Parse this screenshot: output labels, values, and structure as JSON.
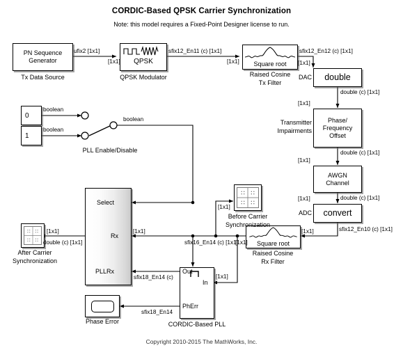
{
  "header": {
    "title": "CORDIC-Based QPSK Carrier Synchronization",
    "note": "Note: this model requires a Fixed-Point Designer license to run."
  },
  "footer": {
    "copyright": "Copyright 2010-2015 The MathWorks, Inc."
  },
  "blocks": {
    "pn_sequence": {
      "label": "PN Sequence\nGenerator",
      "caption": "Tx Data Source"
    },
    "qpsk_modulator": {
      "label": "QPSK",
      "caption": "QPSK Modulator",
      "icon": "pulse-and-sine-icon"
    },
    "tx_filter": {
      "label": "Square root",
      "caption": "Raised Cosine\nTx Filter",
      "icon": "raised-cosine-icon"
    },
    "dac": {
      "label": "double",
      "caption": "DAC"
    },
    "phase_freq_offset": {
      "label": "Phase/\nFrequency\nOffset",
      "caption": "Transmitter\nImpairments"
    },
    "awgn": {
      "label": "AWGN\nChannel"
    },
    "adc": {
      "label": "convert",
      "caption": "ADC"
    },
    "rx_filter": {
      "label": "Square root",
      "caption": "Raised Cosine\nRx Filter",
      "icon": "raised-cosine-icon"
    },
    "const_zero": {
      "label": "0"
    },
    "const_one": {
      "label": "1"
    },
    "manual_switch": {
      "caption": "PLL Enable/Disable",
      "state": "1"
    },
    "select_switch": {
      "ports": [
        "Select",
        "Rx",
        "PLLRx"
      ]
    },
    "cordic_pll": {
      "caption": "CORDIC-Based PLL",
      "ports_left": [
        "Out",
        "PhErr"
      ],
      "ports_right": [
        "In"
      ],
      "icon": "pulse-icon"
    },
    "scope_before": {
      "caption": "Before Carrier\nSynchronization",
      "icon": "constellation-scope-icon"
    },
    "scope_after": {
      "caption": "After Carrier\nSynchronization",
      "icon": "constellation-scope-icon"
    },
    "scope_phase_error": {
      "caption": "Phase Error",
      "icon": "scope-icon"
    }
  },
  "signals": {
    "s01": "ufix2 [1x1]",
    "s02": "[1x1]",
    "s03": "sfix12_En11 (c) [1x1]",
    "s04": "[1x1]",
    "s05": "sfix12_En12 (c) [1x1]",
    "s06": "[1x1]",
    "s07": "double (c) [1x1]",
    "s08": "[1x1]",
    "s09": "double (c) [1x1]",
    "s10": "[1x1]",
    "s11": "double (c) [1x1]",
    "s12": "[1x1]",
    "s13": "sfix12_En10 (c) [1x1]",
    "s14": "[1x1]",
    "s15": "sfix16_En14 (c) [1x1]",
    "s16": "[1x1]",
    "s17": "[1x1]",
    "s18": "double (c) [1x1]",
    "s19": "[1x1]",
    "s20": "sfix18_En14 (c)",
    "s21": "sfix18_En14",
    "s22": "[1x1]",
    "bool_top": "boolean",
    "bool_bottom": "boolean",
    "bool_out": "boolean"
  },
  "colors": {
    "block_border": "#000000",
    "background": "#ffffff",
    "shadow": "#5a5a5a",
    "gradient_dark": "#c9c9c9"
  }
}
